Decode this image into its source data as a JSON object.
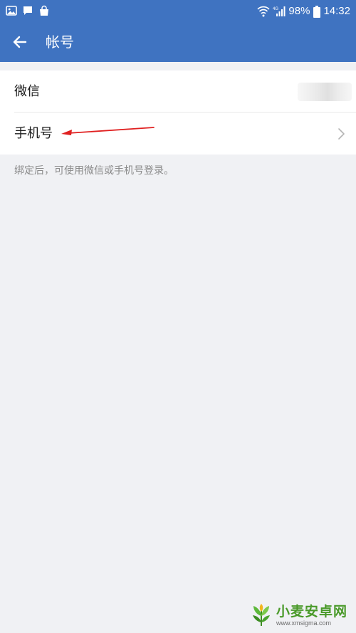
{
  "status_bar": {
    "battery_percent": "98%",
    "time": "14:32",
    "left_icons": [
      "gallery-icon",
      "chat-icon",
      "shopping-bag-icon"
    ],
    "right_icons": [
      "wifi-icon",
      "signal-icon",
      "battery-icon"
    ]
  },
  "app_bar": {
    "title": "帐号",
    "back_icon": "arrow-left-icon",
    "background": "#3f73c1"
  },
  "rows": [
    {
      "label": "微信",
      "value_masked": true
    },
    {
      "label": "手机号",
      "trailing_icon": "chevron-right-icon"
    }
  ],
  "hint": "绑定后，可使用微信或手机号登录。",
  "annotation": {
    "type": "arrow",
    "color": "#e02020",
    "points_to": "手机号"
  },
  "watermark": {
    "name": "小麦安卓网",
    "url": "www.xmsigma.com"
  }
}
